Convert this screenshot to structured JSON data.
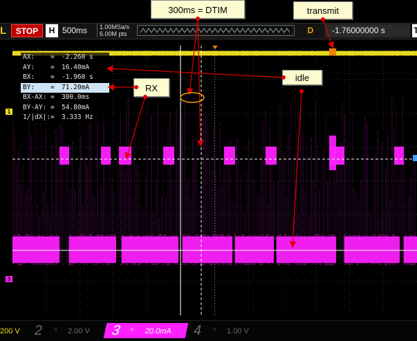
{
  "toolbar": {
    "logo_letter": "L",
    "run_state": "STOP",
    "h_label": "H",
    "timebase": "500ms",
    "sample_rate": "1.00MSa/s",
    "memory_depth": "6.00M pts",
    "trigger_mode_label": "D",
    "trigger_delay": "-1.76000000 s",
    "t_label": "T"
  },
  "measurements": [
    {
      "key": "AX:",
      "eq": "=",
      "value": "-2.260 s"
    },
    {
      "key": "AY:",
      "eq": "=",
      "value": "16.40mA"
    },
    {
      "key": "BX:",
      "eq": "=",
      "value": "-1.960 s"
    },
    {
      "key": "BY:",
      "eq": "=",
      "value": "71.20mA"
    },
    {
      "key": "BX-AX:",
      "eq": "=",
      "value": "300.0ms"
    },
    {
      "key": "BY-AY:",
      "eq": "=",
      "value": "54.80mA"
    },
    {
      "key": "1/|dX|:",
      "eq": "=",
      "value": "3.333 Hz"
    }
  ],
  "annotations": {
    "dtim": "300ms = DTIM",
    "transmit": "transmit",
    "idle": "idle",
    "rx": "RX"
  },
  "channels": [
    {
      "num": "1",
      "value": "200 V"
    },
    {
      "num": "2",
      "value": "2.00 V"
    },
    {
      "num": "3",
      "value": "20.0mA"
    },
    {
      "num": "4",
      "value": "1.00 V"
    }
  ],
  "channel_markers": {
    "ch1": "1",
    "ch3": "3"
  },
  "colors": {
    "ch1": "#f0e020",
    "ch3": "#ff20ff",
    "stop": "#c00000",
    "callout_bg": "#fdfbd0",
    "arrow": "#e00000",
    "cursor_b_ellipse": "#f0a000"
  }
}
